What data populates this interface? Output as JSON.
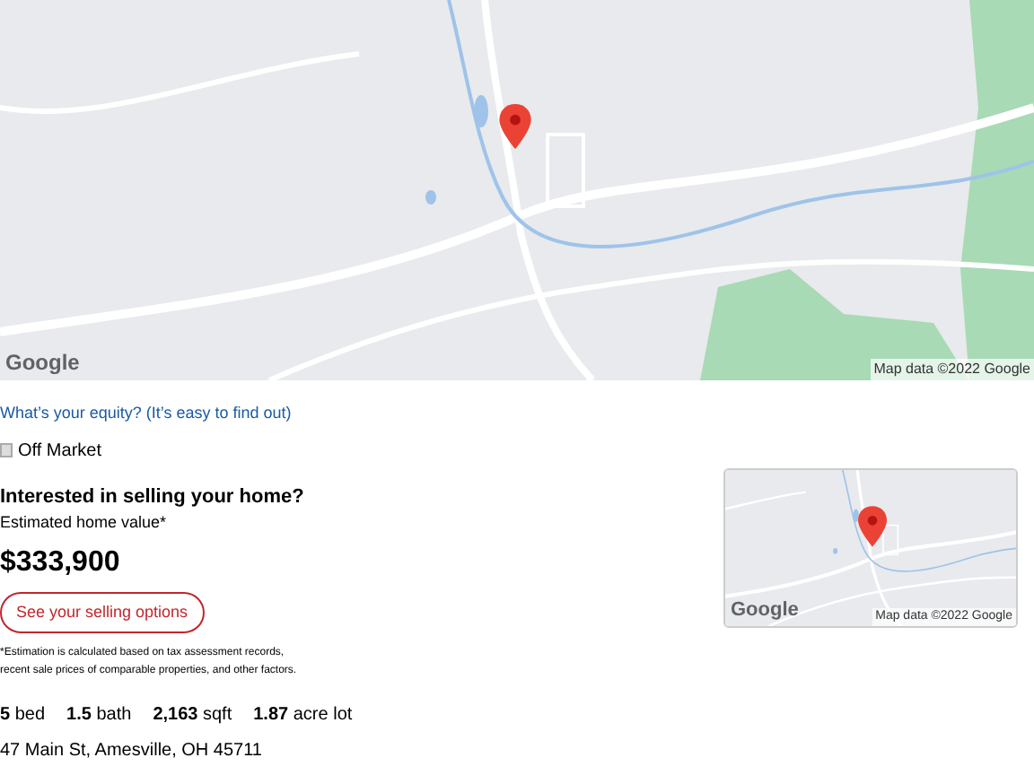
{
  "map": {
    "kind": "picture",
    "logo": "Google",
    "attribution": "Map data ©2022 Google"
  },
  "equity_link": "What’s your equity? (It’s easy to find out)",
  "status": {
    "label": "Off Market",
    "checked": false
  },
  "selling": {
    "heading": "Interested in selling your home?",
    "value_label": "Estimated home value*",
    "value": "$333,900",
    "button": "See your selling options",
    "footnote": [
      "*Estimation is calculated based on tax assessment records,",
      "recent sale prices of comparable properties, and other factors."
    ]
  },
  "mini_map": {
    "kind": "picture",
    "logo": "Google",
    "attribution": "Map data ©2022 Google"
  },
  "facts": [
    {
      "value": "5",
      "unit": "bed"
    },
    {
      "value": "1.5",
      "unit": "bath"
    },
    {
      "value": "2,163",
      "unit": "sqft"
    },
    {
      "value": "1.87",
      "unit": "acre lot"
    }
  ],
  "address": "47 Main St, Amesville, OH 45711"
}
